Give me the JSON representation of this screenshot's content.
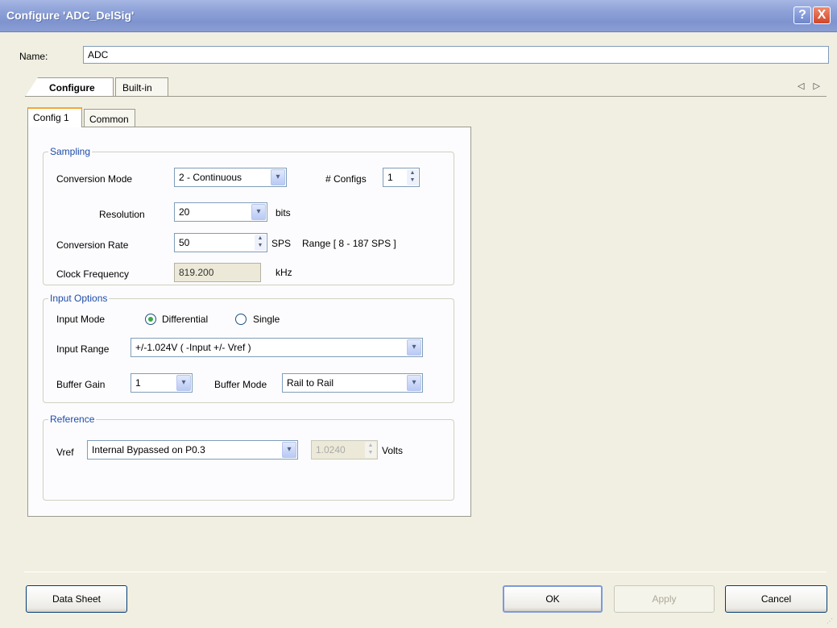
{
  "window": {
    "title": "Configure 'ADC_DelSig'",
    "help_glyph": "?",
    "close_glyph": "X"
  },
  "name_field": {
    "label": "Name:",
    "value": "ADC"
  },
  "outer_tabs": [
    {
      "label": "Configure",
      "active": true
    },
    {
      "label": "Built-in",
      "active": false
    }
  ],
  "scroll_arrows": "◁ ▷",
  "inner_tabs": [
    {
      "label": "Config 1",
      "active": true
    },
    {
      "label": "Common",
      "active": false
    }
  ],
  "sampling": {
    "title": "Sampling",
    "conversion_mode": {
      "label": "Conversion Mode",
      "value": "2 - Continuous"
    },
    "num_configs": {
      "label": "# Configs",
      "value": "1"
    },
    "resolution": {
      "label": "Resolution",
      "value": "20",
      "unit": "bits"
    },
    "conversion_rate": {
      "label": "Conversion Rate",
      "value": "50",
      "unit": "SPS",
      "range": "Range [ 8 - 187 SPS ]"
    },
    "clock_frequency": {
      "label": "Clock Frequency",
      "value": "819.200",
      "unit": "kHz"
    }
  },
  "input_options": {
    "title": "Input Options",
    "input_mode": {
      "label": "Input Mode",
      "options": [
        "Differential",
        "Single"
      ],
      "selected": "Differential"
    },
    "input_range": {
      "label": "Input Range",
      "value": "+/-1.024V ( -Input +/- Vref )"
    },
    "buffer_gain": {
      "label": "Buffer Gain",
      "value": "1"
    },
    "buffer_mode": {
      "label": "Buffer Mode",
      "value": "Rail to Rail"
    }
  },
  "reference": {
    "title": "Reference",
    "vref": {
      "label": "Vref",
      "value": "Internal Bypassed on P0.3"
    },
    "voltage": {
      "value": "1.0240",
      "unit": "Volts"
    }
  },
  "buttons": {
    "data_sheet": "Data Sheet",
    "ok": "OK",
    "apply": "Apply",
    "cancel": "Cancel"
  },
  "icons": {
    "dropdown": "▾",
    "spin_up": "▲",
    "spin_down": "▼"
  }
}
